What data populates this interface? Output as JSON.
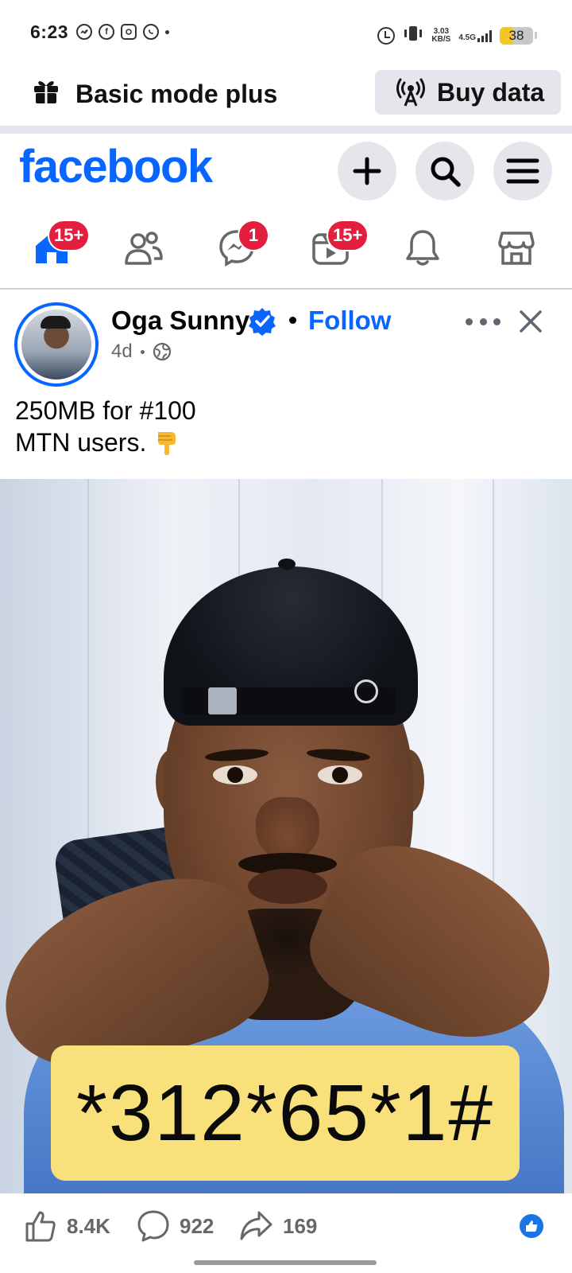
{
  "status_bar": {
    "time": "6:23",
    "left_icons": [
      "messenger-icon",
      "facebook-icon",
      "instagram-icon",
      "whatsapp-icon"
    ],
    "net_speed_value": "3.03",
    "net_speed_unit": "KB/S",
    "network_type": "4.5G",
    "battery_level": "38",
    "battery_fraction": 0.38
  },
  "mode_bar": {
    "label": "Basic mode plus",
    "buy_data_label": "Buy data"
  },
  "header": {
    "logo": "facebook",
    "icons": [
      "plus-icon",
      "search-icon",
      "menu-icon"
    ]
  },
  "tabs": [
    {
      "name": "home",
      "badge": "15+"
    },
    {
      "name": "friends",
      "badge": ""
    },
    {
      "name": "messenger",
      "badge": "1"
    },
    {
      "name": "video",
      "badge": "15+"
    },
    {
      "name": "notifications",
      "badge": ""
    },
    {
      "name": "marketplace",
      "badge": ""
    }
  ],
  "post": {
    "author": "Oga Sunny",
    "follow_label": "Follow",
    "time_ago": "4d",
    "text_line1": "250MB for #100",
    "text_line2": "MTN users.",
    "image_code": "*312*65*1#",
    "likes": "8.4K",
    "comments": "922",
    "shares": "169"
  },
  "colors": {
    "brand": "#0866ff",
    "badge": "#e41e3f",
    "code_box": "#f8e07b"
  }
}
